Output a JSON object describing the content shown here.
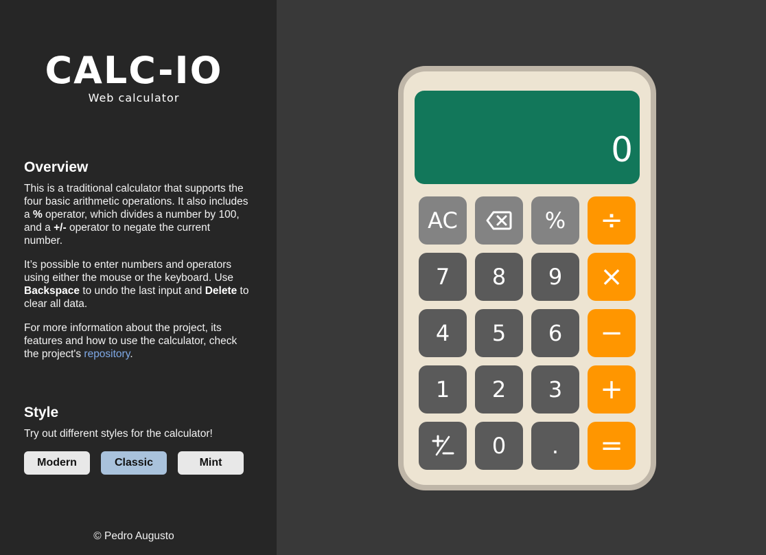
{
  "sidebar": {
    "logo": "CALC-IO",
    "subtitle": "Web calculator",
    "overview_title": "Overview",
    "overview_p1": {
      "t1": "This is a traditional calculator that supports the four basic arithmetic operations. It also includes a ",
      "b1": "%",
      "t2": " operator, which divides a number by 100, and a ",
      "b2": "+/-",
      "t3": " operator to negate the current number."
    },
    "overview_p2": {
      "t1": "It’s possible to enter numbers and operators using either the mouse or the keyboard. Use ",
      "b1": "Backspace",
      "t2": " to undo the last input and ",
      "b2": "Delete",
      "t3": " to clear all data."
    },
    "overview_p3": {
      "t1": "For more information about the project, its features and how to use the calculator, check the project's ",
      "link": "repository",
      "t2": "."
    },
    "style_title": "Style",
    "style_desc": "Try out different styles for the calculator!",
    "style_buttons": [
      "Modern",
      "Classic",
      "Mint"
    ],
    "active_style": "Classic",
    "footer": "© Pedro Augusto"
  },
  "calculator": {
    "display": "0",
    "keys": {
      "clear": "AC",
      "backspace": "backspace-icon",
      "percent": "%",
      "divide": "÷",
      "seven": "7",
      "eight": "8",
      "nine": "9",
      "multiply": "×",
      "four": "4",
      "five": "5",
      "six": "6",
      "subtract": "−",
      "one": "1",
      "two": "2",
      "three": "3",
      "add": "+",
      "negate": "+/-",
      "zero": "0",
      "decimal": ".",
      "equals": "="
    }
  },
  "colors": {
    "sidebar_bg": "#262626",
    "page_bg": "#393939",
    "calc_body": "#ede4d2",
    "calc_border": "#bfb6a8",
    "display_bg": "#12775a",
    "fn_key": "#838383",
    "num_key": "#5a5a5a",
    "op_key": "#ff9600",
    "active_style_btn": "#a9c2dc",
    "link": "#7fa9e6"
  }
}
